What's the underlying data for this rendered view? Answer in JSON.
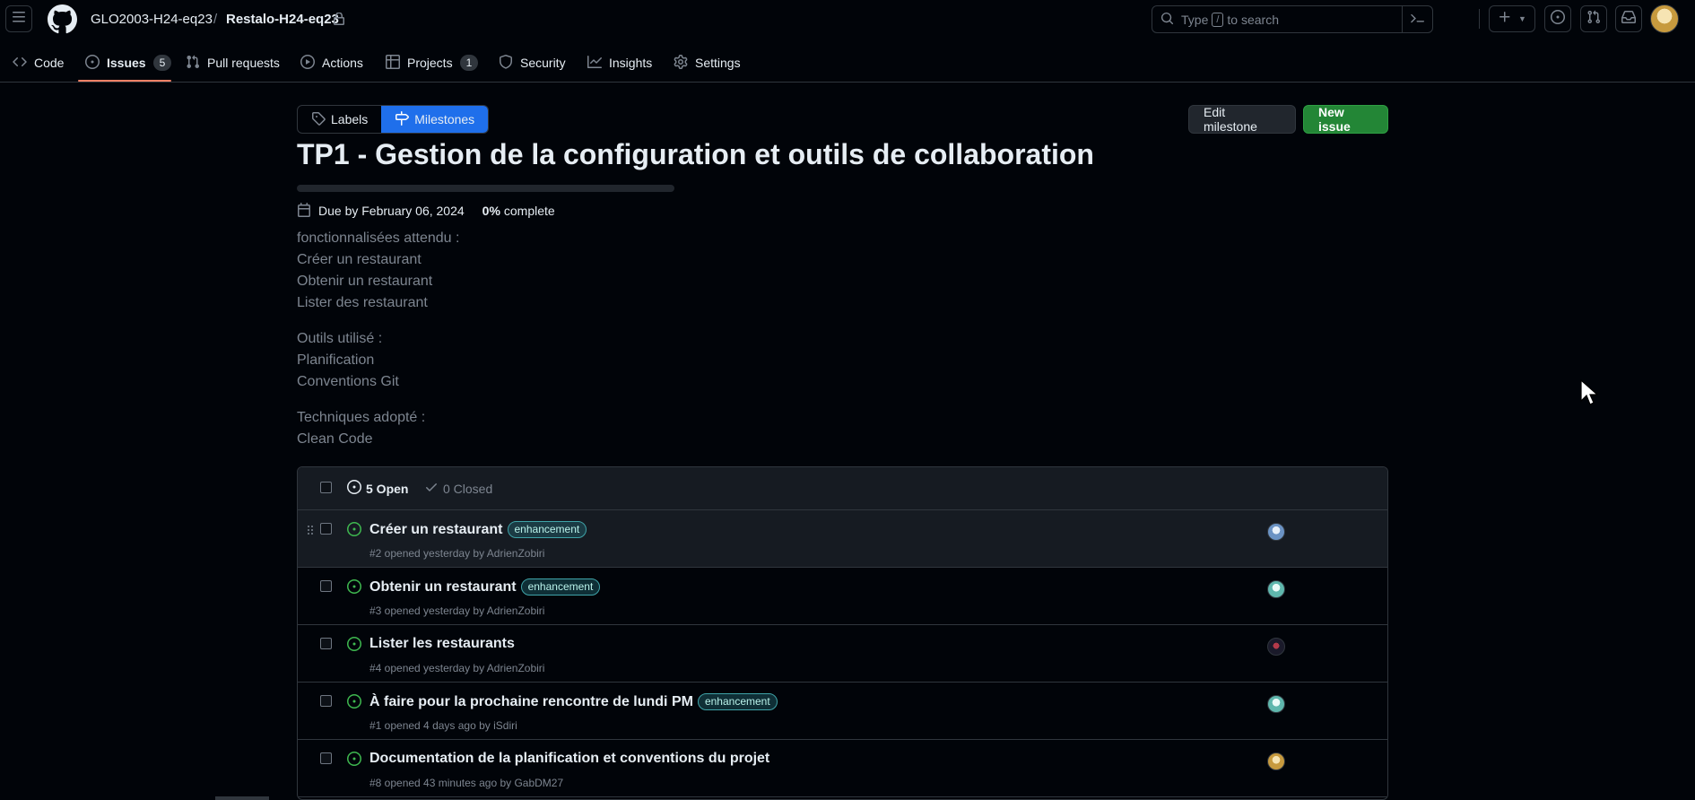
{
  "header": {
    "owner": "GLO2003-H24-eq23",
    "separator": "/",
    "repo": "Restalo-H24-eq23",
    "search_placeholder_prefix": "Type",
    "search_placeholder_key": "/",
    "search_placeholder_suffix": "to search",
    "icons": [
      "hamburger-icon",
      "github-logo",
      "lock-icon",
      "search-icon",
      "command-palette-icon",
      "plus-icon",
      "issue-opened-icon",
      "pull-request-icon",
      "inbox-icon"
    ]
  },
  "nav": {
    "code": "Code",
    "issues": "Issues",
    "issues_count": "5",
    "pulls": "Pull requests",
    "actions": "Actions",
    "projects": "Projects",
    "projects_count": "1",
    "security": "Security",
    "insights": "Insights",
    "settings": "Settings"
  },
  "subnav": {
    "labels": "Labels",
    "milestones": "Milestones"
  },
  "buttons": {
    "edit_milestone": "Edit milestone",
    "new_issue": "New issue"
  },
  "milestone": {
    "title": "TP1 - Gestion de la configuration et outils de collaboration",
    "due": "Due by February 06, 2024",
    "percent": "0%",
    "percent_label": "complete",
    "progress_fraction": 0,
    "description": {
      "block1": [
        "fonctionnalisées attendu :",
        "Créer un restaurant",
        "Obtenir un restaurant",
        "Lister des restaurant"
      ],
      "block2": [
        "Outils utilisé :",
        "Planification",
        "Conventions Git"
      ],
      "block3": [
        "Techniques adopté :",
        "Clean Code"
      ]
    }
  },
  "issues": {
    "open_label": "5 Open",
    "closed_label": "0 Closed",
    "items": [
      {
        "title": "Créer un restaurant",
        "label": "enhancement",
        "meta": "#2 opened yesterday by AdrienZobiri"
      },
      {
        "title": "Obtenir un restaurant",
        "label": "enhancement",
        "meta": "#3 opened yesterday by AdrienZobiri"
      },
      {
        "title": "Lister les restaurants",
        "label": "",
        "meta": "#4 opened yesterday by AdrienZobiri"
      },
      {
        "title": "À faire pour la prochaine rencontre de lundi PM",
        "label": "enhancement",
        "meta": "#1 opened 4 days ago by iSdiri"
      },
      {
        "title": "Documentation de la planification et conventions du projet",
        "label": "",
        "meta": "#8 opened 43 minutes ago by GabDM27"
      }
    ]
  },
  "colors": {
    "accent_blue": "#1f6feb",
    "primary_green": "#238636",
    "open_green": "#3fb950",
    "tab_underline": "#f78166",
    "label_teal": "#3fa3a8"
  }
}
